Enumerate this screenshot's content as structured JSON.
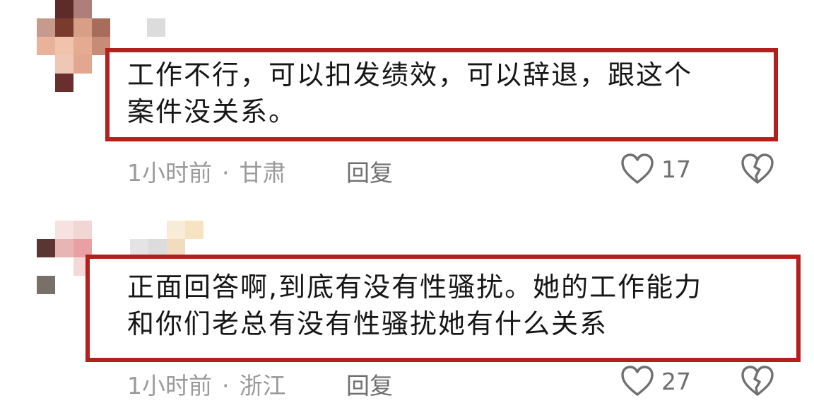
{
  "comments": [
    {
      "text_line1": "工作不行，可以扣发绩效，可以辞退，跟这个",
      "text_line2": "案件没关系。",
      "time": "1小时前",
      "separator": "·",
      "location": "甘肃",
      "reply_label": "回复",
      "likes": "17",
      "highlight_color": "#b3201c"
    },
    {
      "text_line1": "正面回答啊,到底有没有性骚扰。她的工作能力",
      "text_line2": "和你们老总有没有性骚扰她有什么关系",
      "time": "1小时前",
      "separator": "·",
      "location": "浙江",
      "reply_label": "回复",
      "likes": "27",
      "highlight_color": "#b3201c"
    }
  ],
  "icons": {
    "like": "heart-outline-icon",
    "dislike": "broken-heart-icon"
  }
}
